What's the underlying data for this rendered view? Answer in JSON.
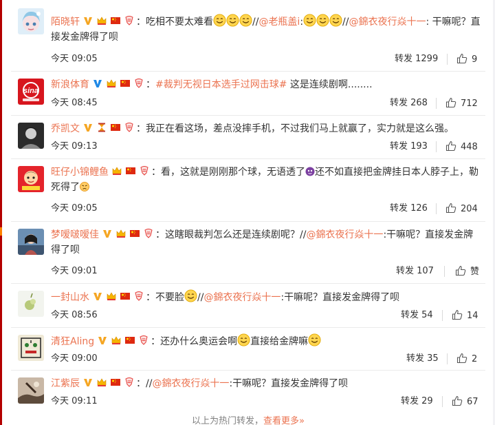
{
  "items": [
    {
      "user": "陌晓轩",
      "badges": [
        "v-gold",
        "crown",
        "flag",
        "ribbon"
      ],
      "segments": [
        {
          "t": "吃相不要太难看"
        },
        {
          "e": "smile"
        },
        {
          "e": "smile"
        },
        {
          "e": "smile"
        },
        {
          "t": "//"
        },
        {
          "l": "@老瓶盖i"
        },
        {
          "t": ":"
        },
        {
          "e": "smile"
        },
        {
          "e": "smile"
        },
        {
          "e": "smile"
        },
        {
          "t": "//"
        },
        {
          "l": "@錦衣夜行焱十一"
        },
        {
          "t": ": 干嘛呢？直接发金牌得了呗"
        }
      ],
      "time": "今天 09:05",
      "forward": "转发 1299",
      "like": "9"
    },
    {
      "user": "新浪体育",
      "badges": [
        "v-blue",
        "crown",
        "flag",
        "ribbon"
      ],
      "segments": [
        {
          "l": "#裁判无视日本选手过网击球#"
        },
        {
          "t": " 这是连续剧啊........"
        }
      ],
      "time": "今天 08:45",
      "forward": "转发 268",
      "like": "712"
    },
    {
      "user": "乔凯文",
      "badges": [
        "v-gold",
        "hourglass",
        "flag",
        "ribbon"
      ],
      "segments": [
        {
          "t": "我正在看这场，差点没摔手机，不过我们马上就赢了，实力就是这么强。"
        }
      ],
      "time": "今天 09:13",
      "forward": "转发 193",
      "like": "448"
    },
    {
      "user": "旺仔小锦鲤鱼",
      "badges": [
        "crown",
        "flag",
        "ribbon"
      ],
      "segments": [
        {
          "t": "看，这就是刚刚那个球，无语透了"
        },
        {
          "e": "doge-small"
        },
        {
          "t": "还不如直接把金牌挂日本人脖子上，勒死得了"
        },
        {
          "e": "angry-small"
        }
      ],
      "time": "今天 09:05",
      "forward": "转发 126",
      "like": "204"
    },
    {
      "user": "梦嗳啵嗳佳",
      "badges": [
        "v-gold",
        "crown",
        "flag",
        "ribbon"
      ],
      "segments": [
        {
          "t": "这瞎眼裁判怎么还是连续剧呢？//"
        },
        {
          "l": "@錦衣夜行焱十一"
        },
        {
          "t": ":干嘛呢？直接发金牌得了呗"
        }
      ],
      "time": "今天 09:01",
      "forward": "转发 107",
      "like": "赞"
    },
    {
      "user": "一封山水",
      "badges": [
        "v-gold",
        "crown",
        "flag",
        "ribbon"
      ],
      "segments": [
        {
          "t": "不要脸"
        },
        {
          "e": "smile"
        },
        {
          "t": "//"
        },
        {
          "l": "@錦衣夜行焱十一"
        },
        {
          "t": ":干嘛呢？直接发金牌得了呗"
        }
      ],
      "time": "今天 08:56",
      "forward": "转发 54",
      "like": "14"
    },
    {
      "user": "清狂Aling",
      "badges": [
        "v-gold",
        "crown",
        "flag",
        "ribbon"
      ],
      "segments": [
        {
          "t": "还办什么奥运会啊"
        },
        {
          "e": "smile"
        },
        {
          "t": "直接给金牌嘛"
        },
        {
          "e": "smile"
        }
      ],
      "time": "今天 09:00",
      "forward": "转发 35",
      "like": "2"
    },
    {
      "user": "江紫辰",
      "badges": [
        "v-gold",
        "crown",
        "flag",
        "ribbon"
      ],
      "segments": [
        {
          "t": "//"
        },
        {
          "l": "@錦衣夜行焱十一"
        },
        {
          "t": ":干嘛呢？直接发金牌得了呗"
        }
      ],
      "time": "今天 09:11",
      "forward": "转发 29",
      "like": "67"
    }
  ],
  "footer": {
    "prefix": "以上为热门转发，",
    "more": "查看更多»"
  },
  "colors": {
    "accent": "#eb7350",
    "text": "#333333",
    "muted": "#808080",
    "divider": "#eaeaea"
  }
}
